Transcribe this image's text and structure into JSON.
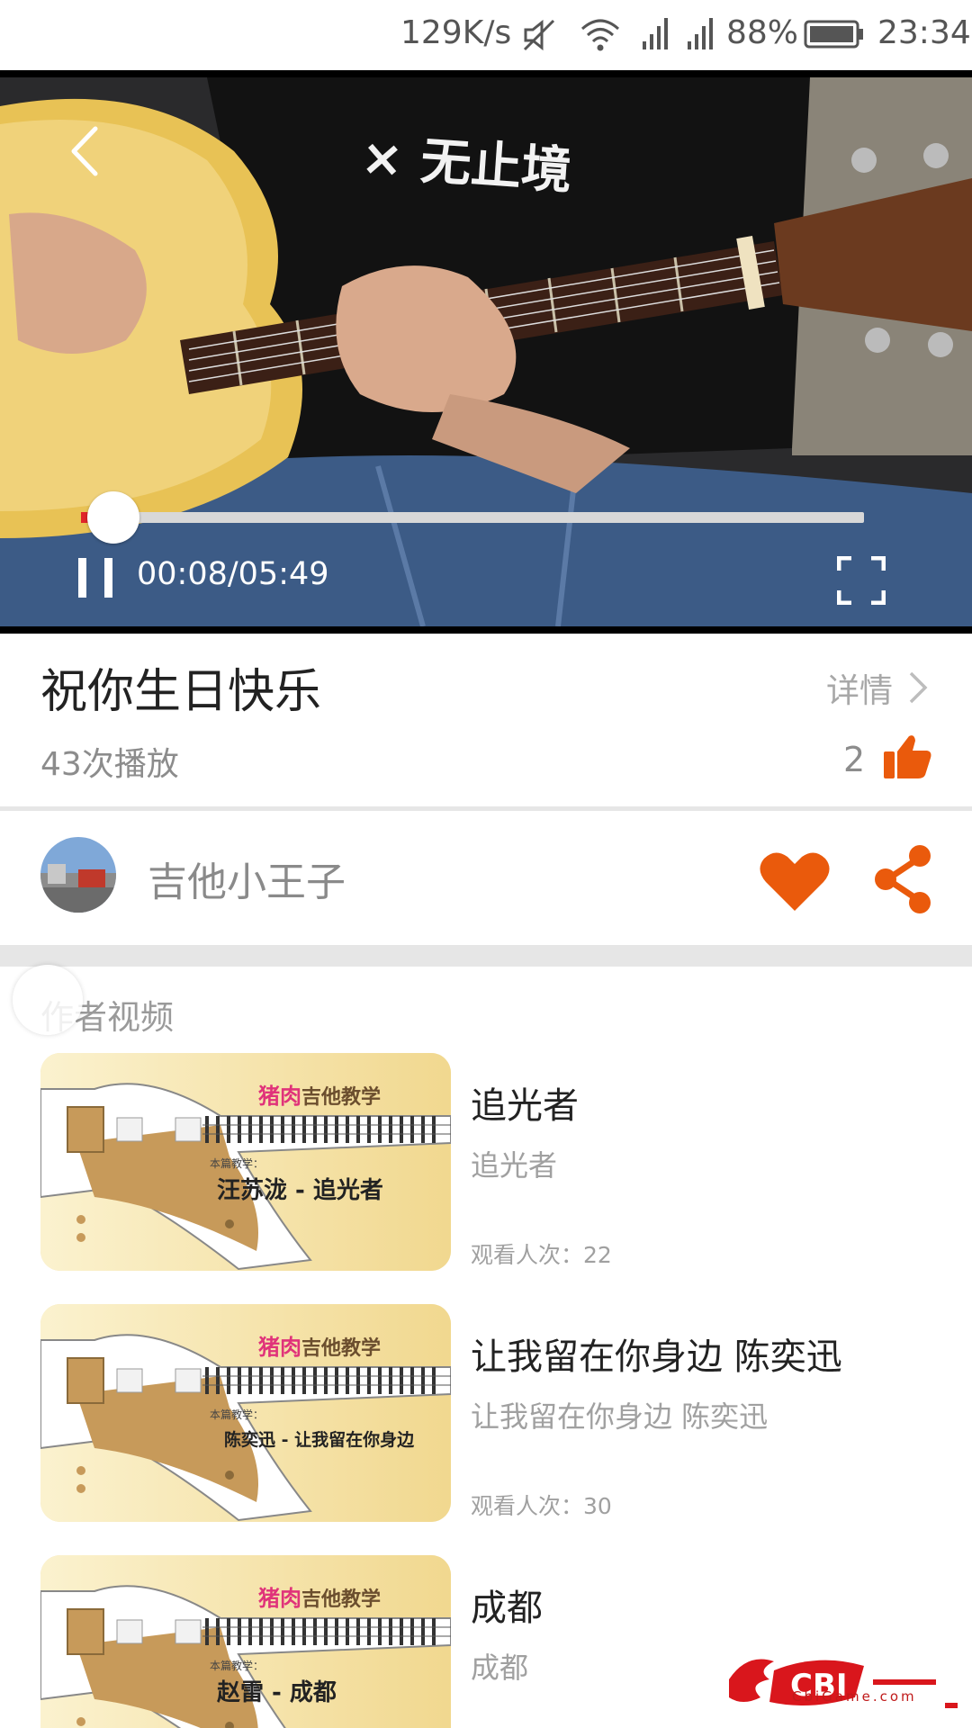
{
  "status_bar": {
    "speed": "129K/s",
    "battery": "88%",
    "time": "23:34",
    "icons": [
      "mute-icon",
      "wifi-icon",
      "signal-icon",
      "signal-icon",
      "battery-icon"
    ]
  },
  "player": {
    "time_display": "00:08/05:49",
    "progress_fraction": 0.023,
    "state": "playing",
    "overlay_text": "× 无止境"
  },
  "video": {
    "title": "祝你生日快乐",
    "detail_label": "详情",
    "plays": "43次播放",
    "likes": "2"
  },
  "author": {
    "name": "吉他小王子"
  },
  "section": {
    "label": "作者视频"
  },
  "list": [
    {
      "title": "追光者",
      "subtitle": "追光者",
      "views": "观看人次：22",
      "thumb_lesson": "汪苏泷 - 追光者"
    },
    {
      "title": "让我留在你身边 陈奕迅",
      "subtitle": "让我留在你身边 陈奕迅",
      "views": "观看人次：30",
      "thumb_lesson": "陈奕迅 - 让我留在你身边"
    },
    {
      "title": "成都",
      "subtitle": "成都",
      "views": "",
      "thumb_lesson": "赵雷 - 成都"
    }
  ],
  "thumb_brand": {
    "highlight": "猪肉",
    "rest": "吉他教学",
    "lesson_head": "本篇教学："
  },
  "watermark": {
    "logo": "CBI",
    "site": "CbiGame.com"
  },
  "colors": {
    "accent": "#ea5a0c",
    "progress": "#e0242a"
  }
}
